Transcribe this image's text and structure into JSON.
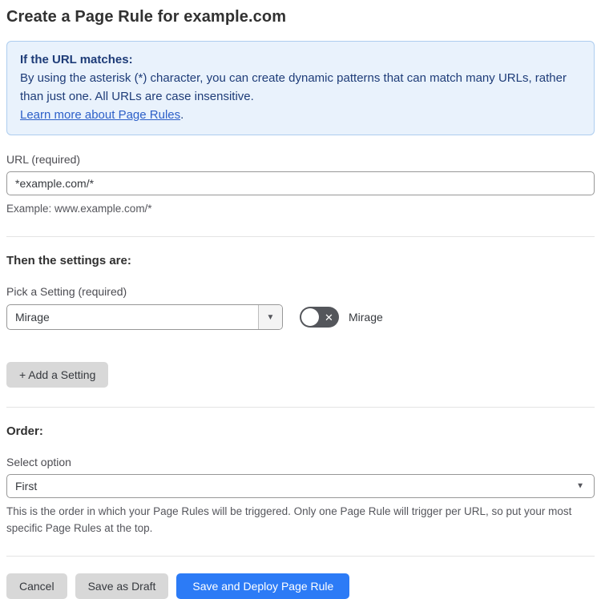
{
  "page": {
    "title": "Create a Page Rule for example.com"
  },
  "info_box": {
    "heading": "If the URL matches:",
    "body": "By using the asterisk (*) character, you can create dynamic patterns that can match many URLs, rather than just one. All URLs are case insensitive.",
    "link_label": "Learn more about Page Rules",
    "link_suffix": "."
  },
  "url_field": {
    "label": "URL (required)",
    "value": "*example.com/*",
    "helper": "Example: www.example.com/*"
  },
  "settings_section": {
    "heading": "Then the settings are:",
    "pick_label": "Pick a Setting (required)",
    "selected_setting": "Mirage",
    "toggle_label": "Mirage",
    "toggle_state": "off",
    "add_button_label": "+ Add a Setting"
  },
  "order_section": {
    "heading": "Order:",
    "select_label": "Select option",
    "selected_option": "First",
    "helper": "This is the order in which your Page Rules will be triggered. Only one Page Rule will trigger per URL, so put your most specific Page Rules at the top."
  },
  "footer": {
    "cancel_label": "Cancel",
    "save_draft_label": "Save as Draft",
    "save_deploy_label": "Save and Deploy Page Rule"
  },
  "icons": {
    "dropdown_arrow": "▼",
    "toggle_close": "✕"
  },
  "colors": {
    "info_background": "#e9f2fc",
    "info_border": "#aecdef",
    "info_text": "#1e3c78",
    "link": "#2c5fc8",
    "primary_button": "#2c7bf6",
    "gray_button": "#d8d8d8",
    "toggle_off": "#54565b",
    "input_border": "#979797"
  }
}
